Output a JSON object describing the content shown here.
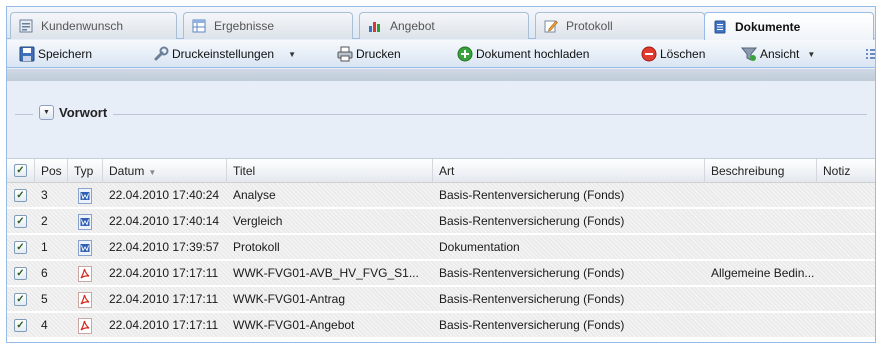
{
  "tabs": [
    {
      "label": "Kundenwunsch",
      "icon": "form-icon",
      "active": false
    },
    {
      "label": "Ergebnisse",
      "icon": "table-icon",
      "active": false
    },
    {
      "label": "Angebot",
      "icon": "bar-chart-icon",
      "active": false
    },
    {
      "label": "Protokoll",
      "icon": "edit-icon",
      "active": false
    },
    {
      "label": "Dokumente",
      "icon": "document-icon",
      "active": true
    }
  ],
  "toolbar": {
    "save_label": "Speichern",
    "print_settings_label": "Druckeinstellungen",
    "print_label": "Drucken",
    "upload_label": "Dokument hochladen",
    "delete_label": "Löschen",
    "view_label": "Ansicht"
  },
  "section": {
    "title": "Vorwort",
    "collapsed_marker": "▼"
  },
  "grid": {
    "columns": {
      "pos": "Pos",
      "typ": "Typ",
      "datum": "Datum",
      "titel": "Titel",
      "art": "Art",
      "beschreibung": "Beschreibung",
      "notiz": "Notiz"
    },
    "sort_marker": "▼",
    "check_mark": "✓",
    "rows": [
      {
        "pos": "3",
        "type": "word",
        "datum": "22.04.2010 17:40:24",
        "titel": "Analyse",
        "art": "Basis-Rentenversicherung (Fonds)",
        "beschreibung": "",
        "notiz": ""
      },
      {
        "pos": "2",
        "type": "word",
        "datum": "22.04.2010 17:40:14",
        "titel": "Vergleich",
        "art": "Basis-Rentenversicherung (Fonds)",
        "beschreibung": "",
        "notiz": ""
      },
      {
        "pos": "1",
        "type": "word",
        "datum": "22.04.2010 17:39:57",
        "titel": "Protokoll",
        "art": "Dokumentation",
        "beschreibung": "",
        "notiz": ""
      },
      {
        "pos": "6",
        "type": "pdf",
        "datum": "22.04.2010 17:17:11",
        "titel": "WWK-FVG01-AVB_HV_FVG_S1...",
        "art": "Basis-Rentenversicherung (Fonds)",
        "beschreibung": "Allgemeine Bedin...",
        "notiz": ""
      },
      {
        "pos": "5",
        "type": "pdf",
        "datum": "22.04.2010 17:17:11",
        "titel": "WWK-FVG01-Antrag",
        "art": "Basis-Rentenversicherung (Fonds)",
        "beschreibung": "",
        "notiz": ""
      },
      {
        "pos": "4",
        "type": "pdf",
        "datum": "22.04.2010 17:17:11",
        "titel": "WWK-FVG01-Angebot",
        "art": "Basis-Rentenversicherung (Fonds)",
        "beschreibung": "",
        "notiz": ""
      }
    ]
  },
  "colors": {
    "accent": "#99bbe8",
    "delete_red": "#e03b2e",
    "upload_green": "#3aa23a",
    "pdf_red": "#d4281c",
    "word_blue": "#2f5fb3"
  }
}
